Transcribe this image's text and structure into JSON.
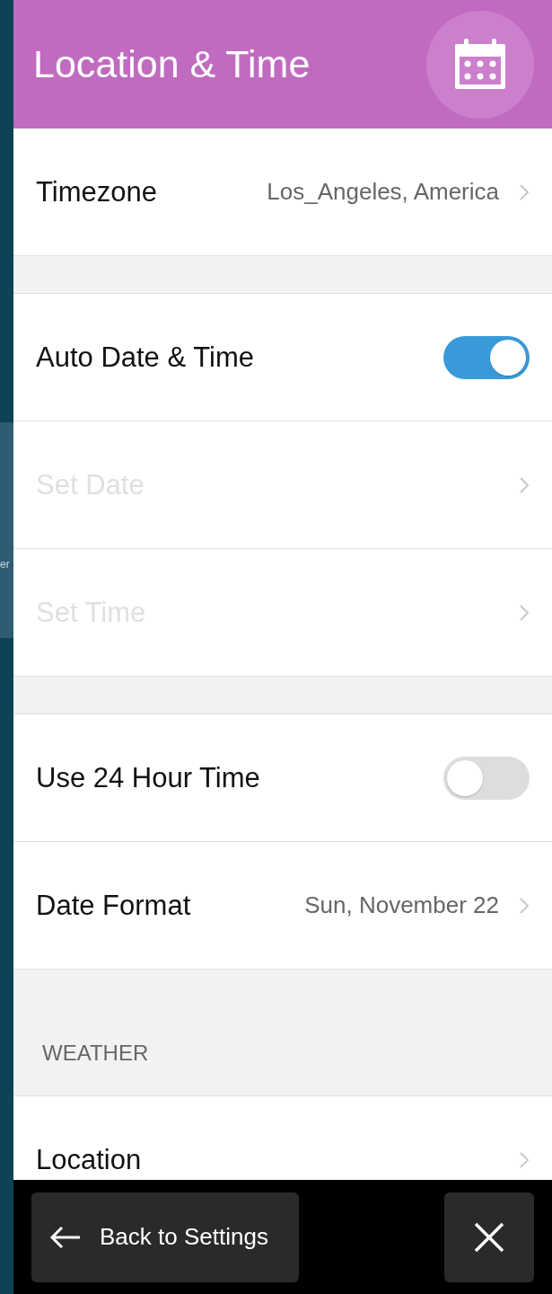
{
  "header": {
    "title": "Location & Time"
  },
  "background_text": "er",
  "groups": [
    {
      "items": [
        {
          "kind": "value",
          "label": "Timezone",
          "value": "Los_Angeles, America",
          "disabled": false
        }
      ]
    },
    {
      "items": [
        {
          "kind": "toggle",
          "label": "Auto Date & Time",
          "on": true
        },
        {
          "kind": "link",
          "label": "Set Date",
          "disabled": true
        },
        {
          "kind": "link",
          "label": "Set Time",
          "disabled": true
        }
      ]
    },
    {
      "items": [
        {
          "kind": "toggle",
          "label": "Use 24 Hour Time",
          "on": false
        },
        {
          "kind": "value",
          "label": "Date Format",
          "value": "Sun, November 22",
          "disabled": false
        }
      ]
    },
    {
      "heading": "WEATHER",
      "items": [
        {
          "kind": "link",
          "label": "Location",
          "disabled": false
        }
      ]
    }
  ],
  "footer": {
    "back_button": "Back to Settings"
  }
}
